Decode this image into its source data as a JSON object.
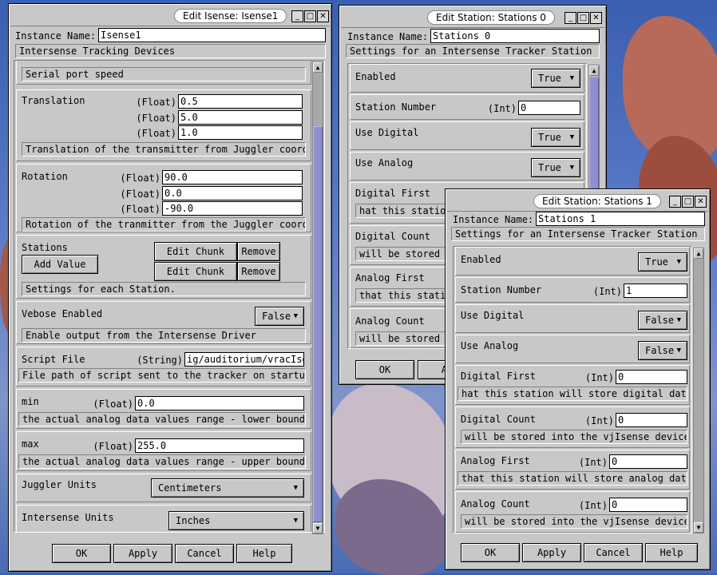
{
  "win1": {
    "title": "Edit Isense: Isense1",
    "instance_label": "Instance Name:",
    "instance_value": "Isense1",
    "subtitle": "Intersense Tracking Devices",
    "serial_desc": "Serial port speed",
    "translation": {
      "label": "Translation",
      "type": "(Float)",
      "values": [
        "0.5",
        "5.0",
        "1.0"
      ],
      "desc": "Translation of the transmitter from Juggler coord"
    },
    "rotation": {
      "label": "Rotation",
      "type": "(Float)",
      "values": [
        "90.0",
        "0.0",
        "-90.0"
      ],
      "desc": "Rotation of the tranmitter from the Juggler coord"
    },
    "stations": {
      "label": "Stations",
      "add_value": "Add Value",
      "edit_chunk": "Edit Chunk",
      "remove": "Remove",
      "desc": "Settings for each Station."
    },
    "verbose": {
      "label": "Vebose Enabled",
      "value": "False",
      "desc": "Enable output from the Intersense Driver"
    },
    "script": {
      "label": "Script File",
      "type": "(String)",
      "value": "ig/auditorium/vracIsense",
      "desc": "File path of script sent to the tracker on startup."
    },
    "min": {
      "label": "min",
      "type": "(Float)",
      "value": "0.0",
      "desc": "the actual analog data values range - lower bound"
    },
    "max": {
      "label": "max",
      "type": "(Float)",
      "value": "255.0",
      "desc": "the actual analog data values range - upper bound"
    },
    "juggler_units": {
      "label": "Juggler Units",
      "value": "Centimeters"
    },
    "intersense_units": {
      "label": "Intersense Units",
      "value": "Inches"
    },
    "buttons": {
      "ok": "OK",
      "apply": "Apply",
      "cancel": "Cancel",
      "help": "Help"
    }
  },
  "win2": {
    "title": "Edit Station: Stations 0",
    "instance_label": "Instance Name:",
    "instance_value": "Stations 0",
    "subtitle": "Settings for an Intersense Tracker Station",
    "enabled": {
      "label": "Enabled",
      "value": "True"
    },
    "station_number": {
      "label": "Station Number",
      "type": "(Int)",
      "value": "0"
    },
    "use_digital": {
      "label": "Use Digital",
      "value": "True"
    },
    "use_analog": {
      "label": "Use Analog",
      "value": "True"
    },
    "digital_first": {
      "label": "Digital First",
      "desc": "hat this station"
    },
    "digital_count": {
      "label": "Digital Count",
      "desc": "will be stored"
    },
    "analog_first": {
      "label": "Analog First",
      "desc": "that this statio"
    },
    "analog_count": {
      "label": "Analog Count",
      "desc": "will be stored"
    },
    "buttons": {
      "ok": "OK",
      "apply": "Ap"
    }
  },
  "win3": {
    "title": "Edit Station: Stations 1",
    "instance_label": "Instance Name:",
    "instance_value": "Stations 1",
    "subtitle": "Settings for an Intersense Tracker Station",
    "enabled": {
      "label": "Enabled",
      "value": "True"
    },
    "station_number": {
      "label": "Station Number",
      "type": "(Int)",
      "value": "1"
    },
    "use_digital": {
      "label": "Use Digital",
      "value": "False"
    },
    "use_analog": {
      "label": "Use Analog",
      "value": "False"
    },
    "digital_first": {
      "label": "Digital First",
      "type": "(Int)",
      "value": "0",
      "desc": "hat this station will store digital data"
    },
    "digital_count": {
      "label": "Digital Count",
      "type": "(Int)",
      "value": "0",
      "desc": "will be stored into the vjIsense device"
    },
    "analog_first": {
      "label": "Analog First",
      "type": "(Int)",
      "value": "0",
      "desc": "that this station will store analog data"
    },
    "analog_count": {
      "label": "Analog Count",
      "type": "(Int)",
      "value": "0",
      "desc": "will be stored into the vjIsense device"
    },
    "buttons": {
      "ok": "OK",
      "apply": "Apply",
      "cancel": "Cancel",
      "help": "Help"
    }
  },
  "window_controls": {
    "minimize": "_",
    "maximize": "□",
    "close": "✕"
  },
  "colors": {
    "window_bg": "#c8c8c8",
    "scroll_thumb": "#8f8fd0",
    "desktop": "#3b5fb0"
  }
}
